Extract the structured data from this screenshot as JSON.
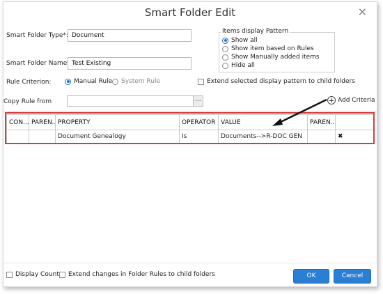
{
  "dialog": {
    "title": "Smart Folder Edit",
    "close_glyph": "×"
  },
  "form": {
    "type_label": "Smart Folder Type*:",
    "type_value": "Document",
    "name_label": "Smart Folder Name*:",
    "name_value": "Test Existing",
    "rule_label": "Rule Criterion:",
    "rule_options": [
      "Manual Rule",
      "System Rule"
    ],
    "rule_selected": "Manual Rule",
    "copy_label": "Copy Rule from",
    "copy_value": "",
    "browse_label": "...",
    "extend_pattern_label": "Extend selected display pattern to child folders"
  },
  "display_pattern": {
    "title": "Items display Pattern",
    "options": [
      "Show all",
      "Show item based on Rules",
      "Show Manually added items",
      "Hide all"
    ],
    "selected": "Show all"
  },
  "add_criteria_label": "Add Criteria",
  "criteria_table": {
    "columns": [
      "CON...",
      "PAREN...",
      "PROPERTY",
      "OPERATOR",
      "VALUE",
      "PAREN...",
      ""
    ],
    "rows": [
      {
        "con": "",
        "paren_open": "",
        "property": "Document Genealogy",
        "operator": "Is",
        "value": "Documents-->R-DOC GEN",
        "paren_close": "",
        "delete_glyph": "✖"
      }
    ]
  },
  "footer": {
    "display_count_label": "Display Count",
    "extend_changes_label": "Extend changes in Folder Rules to child folders",
    "ok_label": "OK",
    "cancel_label": "Cancel"
  },
  "colors": {
    "accent": "#2a7fd4",
    "highlight": "#d63b3b"
  },
  "icons": [
    "close-icon",
    "browse-icon",
    "add-criteria-icon",
    "delete-icon",
    "annotation-arrow"
  ]
}
